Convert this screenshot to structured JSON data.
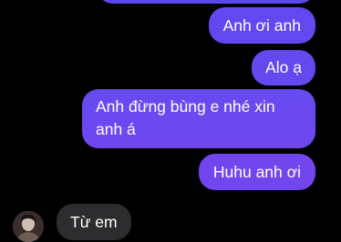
{
  "thread": {
    "messages_out": [
      {
        "text": ""
      },
      {
        "text": "Anh ơi anh"
      },
      {
        "text": "Alo ạ"
      },
      {
        "text": "Anh đừng bùng e nhé xin anh á"
      },
      {
        "text": "Huhu anh ơi"
      }
    ],
    "messages_in": [
      {
        "text": "Từ em"
      }
    ]
  },
  "colors": {
    "background": "#000000",
    "outgoing_bubble": "#6a47f2",
    "incoming_bubble": "#2d2d2f",
    "text": "#ffffff"
  },
  "icons": {
    "avatar": "contact-avatar"
  }
}
